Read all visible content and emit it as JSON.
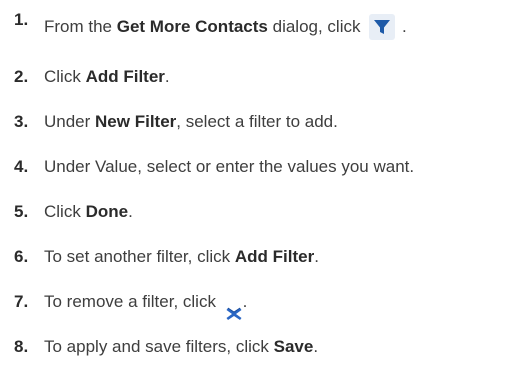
{
  "steps": [
    {
      "num": "1.",
      "parts": [
        "From the ",
        "Get More Contacts",
        " dialog, click ",
        " ."
      ],
      "icon": "filter-icon"
    },
    {
      "num": "2.",
      "parts": [
        "Click ",
        "Add Filter",
        "."
      ]
    },
    {
      "num": "3.",
      "parts": [
        "Under ",
        "New Filter",
        ", select a filter to add."
      ]
    },
    {
      "num": "4.",
      "parts": [
        "Under Value, select or enter the values you want."
      ]
    },
    {
      "num": "5.",
      "parts": [
        "Click ",
        "Done",
        "."
      ]
    },
    {
      "num": "6.",
      "parts": [
        "To set another filter, click ",
        "Add Filter",
        "."
      ]
    },
    {
      "num": "7.",
      "parts": [
        "To remove a filter, click ",
        "."
      ],
      "icon": "remove-x-icon"
    },
    {
      "num": "8.",
      "parts": [
        "To apply and save filters, click ",
        "Save",
        "."
      ]
    }
  ],
  "colors": {
    "filter_icon": "#1e5aa8",
    "remove_icon": "#2a66c4"
  }
}
